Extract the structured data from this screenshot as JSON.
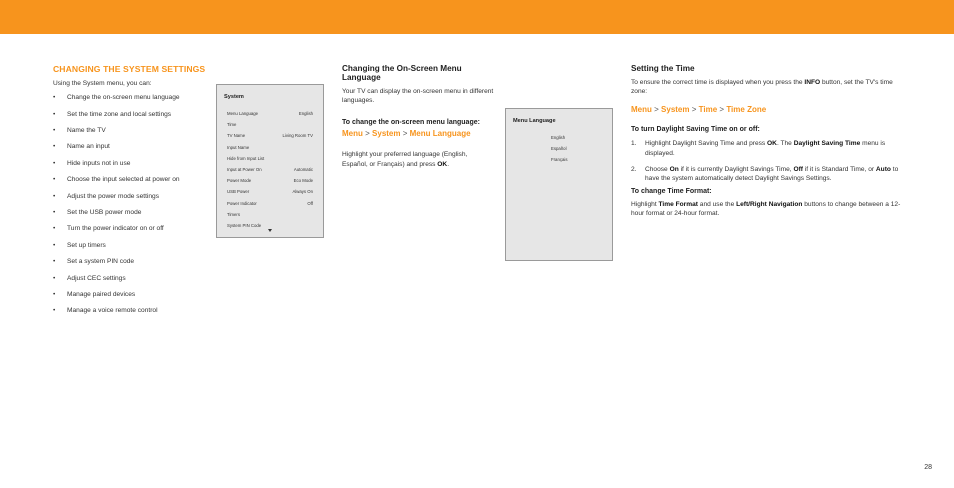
{
  "left": {
    "title": "CHANGING THE SYSTEM SETTINGS",
    "intro": "Using the System menu, you can:",
    "bullets": [
      "Change the on-screen menu language",
      "Set the time zone and local settings",
      "Name the TV",
      "Name an input",
      "Hide inputs not in use",
      "Choose the input selected at power on",
      "Adjust the power mode settings",
      "Set the USB power mode",
      "Turn the power indicator on or off",
      "Set up timers",
      "Set a system PIN code",
      "Adjust CEC settings",
      "Manage paired devices",
      "Manage a voice remote control"
    ]
  },
  "system_panel": {
    "title": "System",
    "rows": [
      {
        "label": "Menu Language",
        "value": "English"
      },
      {
        "label": "Time",
        "value": ""
      },
      {
        "label": "TV Name",
        "value": "Living Room TV"
      },
      {
        "label": "Input Name",
        "value": ""
      },
      {
        "label": "Hide from Input List",
        "value": ""
      },
      {
        "label": "Input at Power On",
        "value": "Automatic"
      },
      {
        "label": "Power Mode",
        "value": "Eco Mode"
      },
      {
        "label": "USB Power",
        "value": "Always On"
      },
      {
        "label": "Power Indicator",
        "value": "Off"
      },
      {
        "label": "Timers",
        "value": ""
      },
      {
        "label": "System PIN Code",
        "value": ""
      }
    ]
  },
  "middle": {
    "title": "Changing the On-Screen Menu Language",
    "intro": "Your TV can display the on-screen menu in different languages.",
    "subheading": "To change the on-screen menu language:",
    "path": [
      "Menu",
      "System",
      "Menu Language"
    ],
    "instruction_pre": "Highlight your preferred language (English, Español, or Français) and press ",
    "instruction_bold": "OK",
    "instruction_post": "."
  },
  "language_panel": {
    "title": "Menu Language",
    "options": [
      "English",
      "Español",
      "Français"
    ]
  },
  "right": {
    "title": "Setting the Time",
    "intro_pre": "To ensure the correct time is displayed when you press the ",
    "intro_bold": "INFO",
    "intro_post": " button, set the TV's time zone:",
    "path": [
      "Menu",
      "System",
      "Time",
      "Time Zone"
    ],
    "dst_heading": "To turn Daylight Saving Time on or off:",
    "step1_num": "1.",
    "step1_a": "Highlight Daylight Saving Time and press ",
    "step1_b": "OK",
    "step1_c": ". The ",
    "step1_d": "Daylight Saving Time",
    "step1_e": " menu is displayed.",
    "step2_num": "2.",
    "step2_a": "Choose ",
    "step2_b": "On",
    "step2_c": " if it is currently Daylight Savings Time, ",
    "step2_d": "Off",
    "step2_e": " if it is Standard Time, or ",
    "step2_f": "Auto",
    "step2_g": " to have the system automatically detect Daylight Savings Settings.",
    "format_heading": "To change Time Format:",
    "format_a": "Highlight ",
    "format_b": "Time Format",
    "format_c": " and use the ",
    "format_d": "Left/Right Navigation",
    "format_e": " buttons to change between a 12-hour format or 24-hour format."
  },
  "page_number": "28",
  "colors": {
    "accent": "#f7941d",
    "panel_bg": "#e6e6e6"
  }
}
